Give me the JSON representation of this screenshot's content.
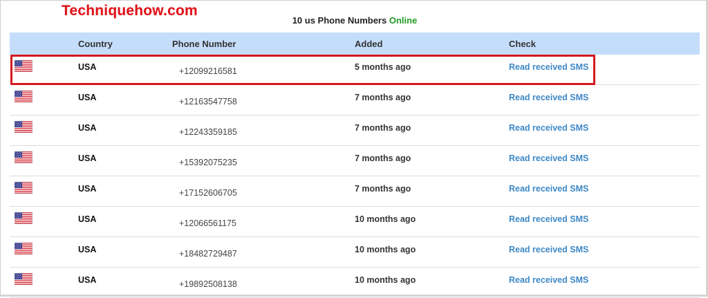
{
  "watermark": "Techniquehow.com",
  "heading": {
    "prefix": "10 us Phone Numbers",
    "status": "Online"
  },
  "columns": [
    "Country",
    "Phone Number",
    "Added",
    "Check"
  ],
  "rows": [
    {
      "flag": "us-flag-icon",
      "country": "USA",
      "phone": "+12099216581",
      "added": "5 months ago",
      "action": "Read received SMS"
    },
    {
      "flag": "us-flag-icon",
      "country": "USA",
      "phone": "+12163547758",
      "added": "7 months ago",
      "action": "Read received SMS"
    },
    {
      "flag": "us-flag-icon",
      "country": "USA",
      "phone": "+12243359185",
      "added": "7 months ago",
      "action": "Read received SMS"
    },
    {
      "flag": "us-flag-icon",
      "country": "USA",
      "phone": "+15392075235",
      "added": "7 months ago",
      "action": "Read received SMS"
    },
    {
      "flag": "us-flag-icon",
      "country": "USA",
      "phone": "+17152606705",
      "added": "7 months ago",
      "action": "Read received SMS"
    },
    {
      "flag": "us-flag-icon",
      "country": "USA",
      "phone": "+12066561175",
      "added": "10 months ago",
      "action": "Read received SMS"
    },
    {
      "flag": "us-flag-icon",
      "country": "USA",
      "phone": "+18482729487",
      "added": "10 months ago",
      "action": "Read received SMS"
    },
    {
      "flag": "us-flag-icon",
      "country": "USA",
      "phone": "+19892508138",
      "added": "10 months ago",
      "action": "Read received SMS"
    }
  ],
  "colors": {
    "header_bg": "#c4ddfa",
    "link": "#3d88c6",
    "online": "#1f9a23",
    "highlight": "#d4181f",
    "watermark": "#e0131a"
  }
}
